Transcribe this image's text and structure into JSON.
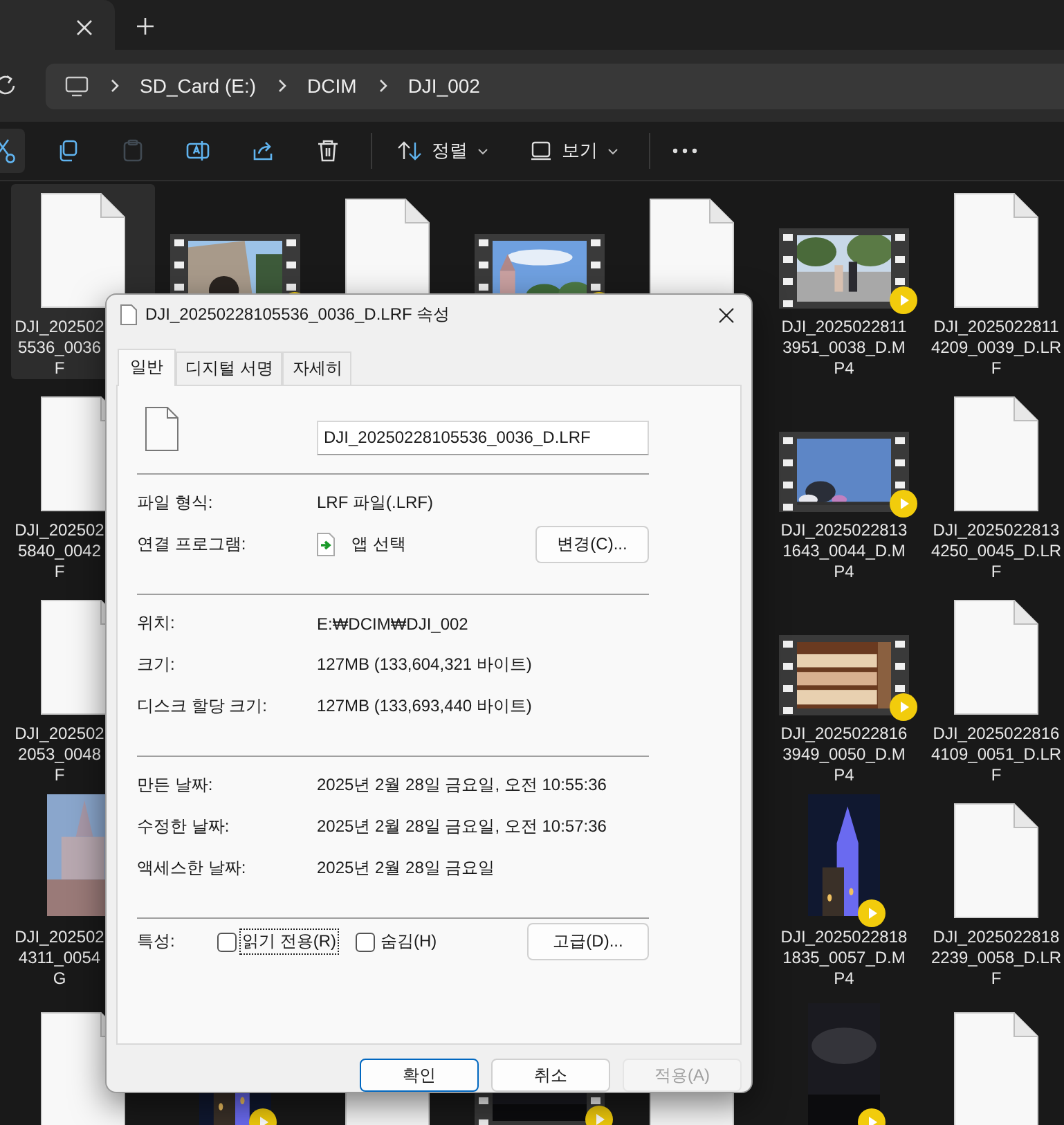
{
  "address_bar": {
    "breadcrumbs": [
      "SD_Card (E:)",
      "DCIM",
      "DJI_002"
    ]
  },
  "toolbar": {
    "actions": [
      {
        "kind": "cut",
        "highlighted": true,
        "disabled": false
      },
      {
        "kind": "copy",
        "highlighted": false,
        "disabled": false
      },
      {
        "kind": "paste",
        "highlighted": false,
        "disabled": true
      },
      {
        "kind": "rename",
        "highlighted": false,
        "disabled": false
      },
      {
        "kind": "share",
        "highlighted": false,
        "disabled": false
      },
      {
        "kind": "delete",
        "highlighted": false,
        "disabled": false
      }
    ],
    "menus": [
      {
        "kind": "sort",
        "label": "정렬"
      },
      {
        "kind": "view",
        "label": "보기"
      }
    ]
  },
  "file_grid": {
    "rows": [
      {
        "items": [
          {
            "kind": "file",
            "selected": true,
            "name_lines": [
              "DJI_202502",
              "5536_0036",
              "F"
            ]
          },
          {
            "kind": "video",
            "portrait": false,
            "selected": false
          },
          {
            "kind": "file",
            "selected": false
          },
          {
            "kind": "video",
            "portrait": false,
            "selected": false
          },
          {
            "kind": "file",
            "selected": false
          },
          {
            "kind": "video",
            "portrait": false,
            "selected": false,
            "name_lines": [
              "DJI_2025022811",
              "3951_0038_D.M",
              "P4"
            ]
          },
          {
            "kind": "file",
            "selected": false,
            "name_lines": [
              "DJI_2025022811",
              "4209_0039_D.LR",
              "F"
            ]
          }
        ]
      },
      {
        "items": [
          {
            "kind": "file",
            "selected": false,
            "name_lines": [
              "DJI_202502",
              "5840_0042",
              "F"
            ]
          },
          {
            "kind": "video",
            "portrait": false,
            "selected": false,
            "name_lines": [
              "DJI_2025022813",
              "1643_0044_D.M",
              "P4"
            ]
          },
          {
            "kind": "file",
            "selected": false,
            "name_lines": [
              "DJI_2025022813",
              "4250_0045_D.LR",
              "F"
            ]
          }
        ]
      },
      {
        "items": [
          {
            "kind": "file",
            "selected": false,
            "name_lines": [
              "DJI_202502",
              "2053_0048",
              "F"
            ]
          },
          {
            "kind": "video",
            "portrait": false,
            "selected": false,
            "name_lines": [
              "DJI_2025022816",
              "3949_0050_D.M",
              "P4"
            ]
          },
          {
            "kind": "file",
            "selected": false,
            "name_lines": [
              "DJI_2025022816",
              "4109_0051_D.LR",
              "F"
            ]
          }
        ]
      },
      {
        "items": [
          {
            "portrait": true,
            "selected": false,
            "name_lines": [
              "DJI_202502",
              "4311_0054",
              "G"
            ]
          },
          {
            "kind": "video",
            "portrait": true,
            "selected": false,
            "name_lines": [
              "DJI_2025022818",
              "1835_0057_D.M",
              "P4"
            ]
          },
          {
            "kind": "file",
            "selected": false,
            "name_lines": [
              "DJI_2025022818",
              "2239_0058_D.LR",
              "F"
            ]
          }
        ]
      },
      {
        "items": [
          {
            "kind": "file",
            "selected": false
          },
          {
            "kind": "video",
            "portrait": true,
            "selected": false
          },
          {
            "kind": "file",
            "selected": false
          },
          {
            "kind": "video",
            "portrait": false,
            "selected": false
          },
          {
            "kind": "file",
            "selected": false
          },
          {
            "kind": "video",
            "portrait": true,
            "selected": false
          },
          {
            "kind": "file",
            "selected": false
          }
        ]
      }
    ]
  },
  "dialog": {
    "title": "DJI_20250228105536_0036_D.LRF 속성",
    "tabs": [
      {
        "label": "일반",
        "selected": true
      },
      {
        "label": "디지털 서명",
        "selected": false
      },
      {
        "label": "자세히",
        "selected": false
      }
    ],
    "file_name": "DJI_20250228105536_0036_D.LRF",
    "sections": [
      [
        {
          "kind": "text",
          "label": "파일 형식:",
          "value": "LRF 파일(.LRF)"
        },
        {
          "kind": "app",
          "label": "연결 프로그램:",
          "value": "앱 선택",
          "button": "변경(C)..."
        }
      ],
      [
        {
          "kind": "text",
          "label": "위치:",
          "value": "E:₩DCIM₩DJI_002"
        },
        {
          "kind": "text",
          "label": "크기:",
          "value": "127MB (133,604,321 바이트)"
        },
        {
          "kind": "text",
          "label": "디스크 할당 크기:",
          "value": "127MB (133,693,440 바이트)"
        }
      ],
      [
        {
          "kind": "text",
          "label": "만든 날짜:",
          "value": "2025년 2월 28일 금요일, 오전 10:55:36"
        },
        {
          "kind": "text",
          "label": "수정한 날짜:",
          "value": "2025년 2월 28일 금요일, 오전 10:57:36"
        },
        {
          "kind": "text",
          "label": "액세스한 날짜:",
          "value": "2025년 2월 28일 금요일"
        }
      ]
    ],
    "attributes": {
      "label": "특성:",
      "checkboxes": [
        {
          "label": "읽기 전용(R)",
          "checked": false,
          "focused": true
        },
        {
          "label": "숨김(H)",
          "checked": false,
          "focused": false
        }
      ],
      "button": "고급(D)..."
    },
    "buttons": [
      {
        "label": "확인",
        "default": true,
        "disabled": false
      },
      {
        "label": "취소",
        "default": false,
        "disabled": false
      },
      {
        "label": "적용(A)",
        "default": false,
        "disabled": true
      }
    ]
  }
}
